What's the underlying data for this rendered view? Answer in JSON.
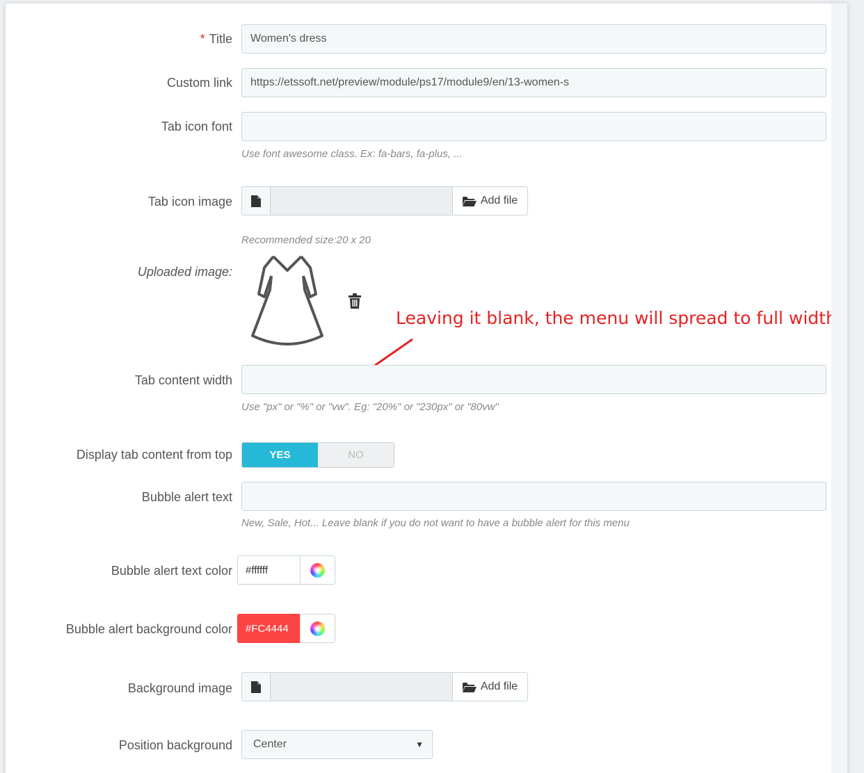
{
  "form": {
    "title": {
      "label": "Title",
      "required_mark": "*",
      "value": "Women's dress"
    },
    "custom_link": {
      "label": "Custom link",
      "value": "https://etssoft.net/preview/module/ps17/module9/en/13-women-s"
    },
    "tab_icon_font": {
      "label": "Tab icon font",
      "value": "",
      "help": "Use font awesome class. Ex: fa-bars, fa-plus, ..."
    },
    "tab_icon_image": {
      "label": "Tab icon image",
      "add_file": "Add file",
      "help": "Recommended size:20 x 20",
      "file_icon": "file-icon",
      "folder_icon": "folder-open-icon"
    },
    "uploaded_image": {
      "label": "Uploaded image:",
      "image": "dress-icon",
      "delete_icon": "trash-icon"
    },
    "tab_content_width": {
      "label": "Tab content width",
      "value": "",
      "help": "Use \"px\" or \"%\" or \"vw\". Eg: \"20%\" or \"230px\" or \"80vw\""
    },
    "display_from_top": {
      "label": "Display tab content from top",
      "yes": "YES",
      "no": "NO",
      "selected": "YES"
    },
    "bubble_alert_text": {
      "label": "Bubble alert text",
      "value": "",
      "help": "New, Sale, Hot... Leave blank if you do not want to have a bubble alert for this menu"
    },
    "bubble_text_color": {
      "label": "Bubble alert text color",
      "value": "#ffffff"
    },
    "bubble_bg_color": {
      "label": "Bubble alert background color",
      "value": "#FC4444",
      "color": "#FC4444"
    },
    "background_image": {
      "label": "Background image",
      "add_file": "Add file"
    },
    "position_background": {
      "label": "Position background",
      "value": "Center"
    }
  },
  "annotation": {
    "text": "Leaving it blank, the menu will spread to full width",
    "color": "#e52222"
  },
  "colors": {
    "accent": "#25b9d7",
    "required": "#e0312a"
  }
}
